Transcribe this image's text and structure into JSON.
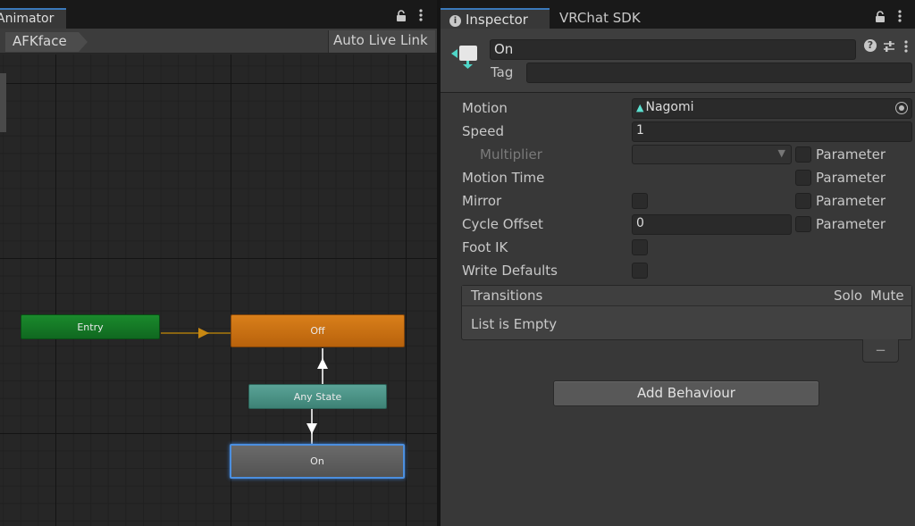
{
  "animator": {
    "tab_label": "Animator",
    "breadcrumb": "AFKface",
    "live_link_label": "Auto Live Link",
    "nodes": {
      "entry": "Entry",
      "off": "Off",
      "any_state": "Any State",
      "on": "On"
    }
  },
  "inspector": {
    "tabs": [
      "Inspector",
      "VRChat SDK"
    ],
    "state_name": "On",
    "tag_label": "Tag",
    "tag_value": "",
    "properties": {
      "motion_label": "Motion",
      "motion_value": "Nagomi",
      "speed_label": "Speed",
      "speed_value": "1",
      "multiplier_label": "Multiplier",
      "motion_time_label": "Motion Time",
      "mirror_label": "Mirror",
      "cycle_offset_label": "Cycle Offset",
      "cycle_offset_value": "0",
      "foot_ik_label": "Foot IK",
      "write_defaults_label": "Write Defaults",
      "parameter_label": "Parameter"
    },
    "transitions": {
      "title": "Transitions",
      "solo": "Solo",
      "mute": "Mute",
      "empty_text": "List is Empty",
      "remove_label": "−"
    },
    "add_behaviour_label": "Add Behaviour"
  },
  "colors": {
    "accent": "#3a79bb",
    "entry_node": "#1a8a2c",
    "off_node": "#d97f1a",
    "any_state_node": "#5aa397",
    "on_node_selected": "#4b8fe0",
    "motion_icon": "#5ce0d0"
  }
}
